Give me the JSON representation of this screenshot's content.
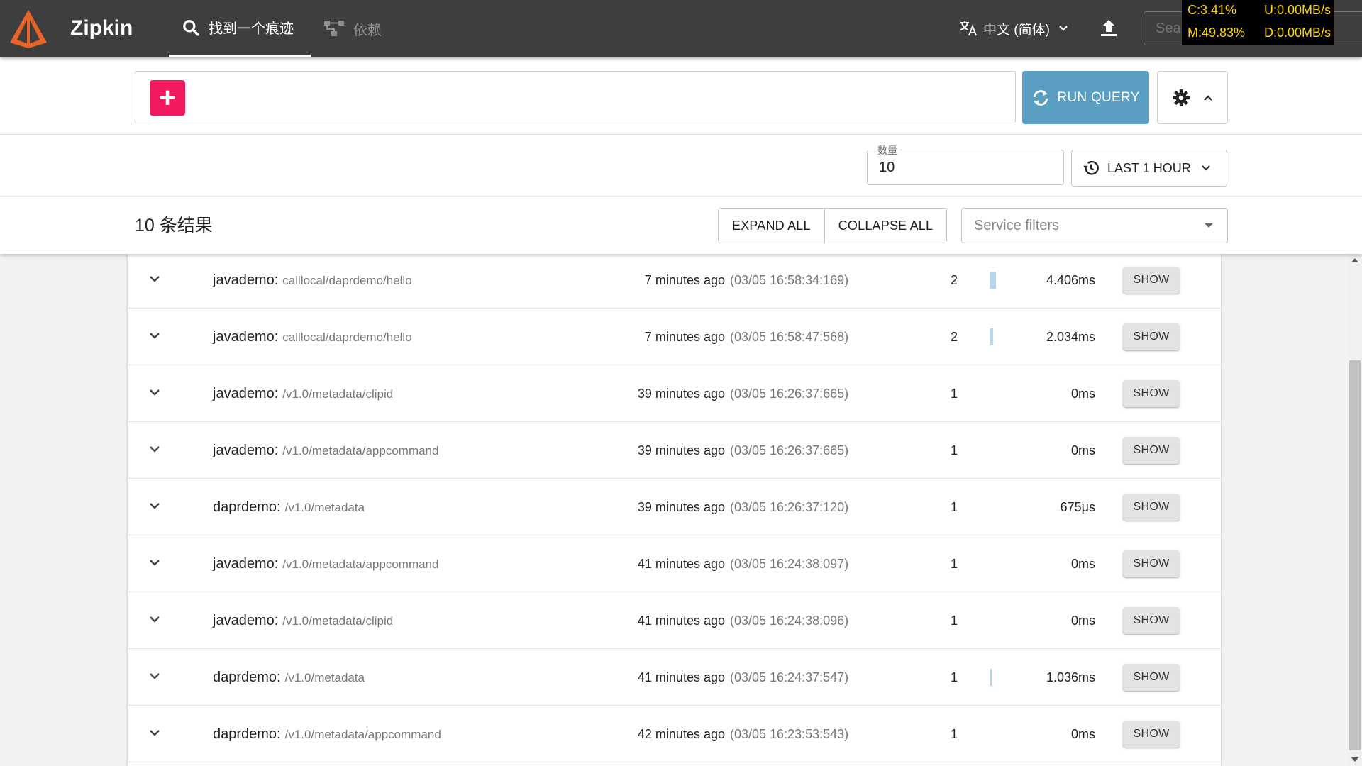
{
  "app": {
    "name": "Zipkin"
  },
  "nav": {
    "find_trace": "找到一个痕迹",
    "dependencies": "依赖"
  },
  "header": {
    "language": "中文 (简体)",
    "search_placeholder": "Search by trace ID"
  },
  "system_monitor": {
    "cpu": "C:3.41%",
    "mem": "M:49.83%",
    "upload": "U:0.00MB/s",
    "download": "D:0.00MB/s"
  },
  "query": {
    "run_label": "RUN QUERY"
  },
  "limit": {
    "label": "数量",
    "value": "10"
  },
  "lookback": {
    "label": "LAST 1 HOUR"
  },
  "results_header": {
    "count_label": "10 条结果",
    "expand_all": "EXPAND ALL",
    "collapse_all": "COLLAPSE ALL",
    "service_filters_placeholder": "Service filters"
  },
  "show_label": "SHOW",
  "colors": {
    "accent_pink": "#f01a5c",
    "run_blue": "#5a9fc2",
    "topbar": "#3e3e3e",
    "duration_bar": "#b7d6ea"
  },
  "results": [
    {
      "service": "javademo:",
      "span": "calllocal/daprdemo/hello",
      "ago": "7 minutes ago",
      "timestamp": "(03/05 16:58:34:169)",
      "spans": "2",
      "duration": "4.406ms",
      "bar_fraction": 1.0
    },
    {
      "service": "javademo:",
      "span": "calllocal/daprdemo/hello",
      "ago": "7 minutes ago",
      "timestamp": "(03/05 16:58:47:568)",
      "spans": "2",
      "duration": "2.034ms",
      "bar_fraction": 0.46
    },
    {
      "service": "javademo:",
      "span": "/v1.0/metadata/clipid",
      "ago": "39 minutes ago",
      "timestamp": "(03/05 16:26:37:665)",
      "spans": "1",
      "duration": "0ms",
      "bar_fraction": 0
    },
    {
      "service": "javademo:",
      "span": "/v1.0/metadata/appcommand",
      "ago": "39 minutes ago",
      "timestamp": "(03/05 16:26:37:665)",
      "spans": "1",
      "duration": "0ms",
      "bar_fraction": 0
    },
    {
      "service": "daprdemo:",
      "span": "/v1.0/metadata",
      "ago": "39 minutes ago",
      "timestamp": "(03/05 16:26:37:120)",
      "spans": "1",
      "duration": "675μs",
      "bar_fraction": 0
    },
    {
      "service": "javademo:",
      "span": "/v1.0/metadata/appcommand",
      "ago": "41 minutes ago",
      "timestamp": "(03/05 16:24:38:097)",
      "spans": "1",
      "duration": "0ms",
      "bar_fraction": 0
    },
    {
      "service": "javademo:",
      "span": "/v1.0/metadata/clipid",
      "ago": "41 minutes ago",
      "timestamp": "(03/05 16:24:38:096)",
      "spans": "1",
      "duration": "0ms",
      "bar_fraction": 0
    },
    {
      "service": "daprdemo:",
      "span": "/v1.0/metadata",
      "ago": "41 minutes ago",
      "timestamp": "(03/05 16:24:37:547)",
      "spans": "1",
      "duration": "1.036ms",
      "bar_fraction": 0.24
    },
    {
      "service": "daprdemo:",
      "span": "/v1.0/metadata/appcommand",
      "ago": "42 minutes ago",
      "timestamp": "(03/05 16:23:53:543)",
      "spans": "1",
      "duration": "0ms",
      "bar_fraction": 0
    }
  ]
}
